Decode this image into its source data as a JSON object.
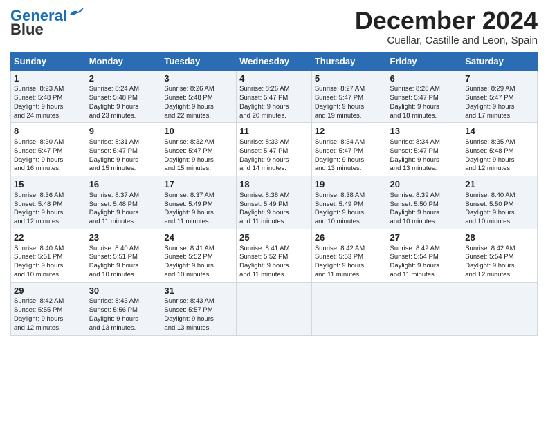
{
  "logo": {
    "line1": "General",
    "line2": "Blue"
  },
  "header": {
    "title": "December 2024",
    "subtitle": "Cuellar, Castille and Leon, Spain"
  },
  "days": [
    "Sunday",
    "Monday",
    "Tuesday",
    "Wednesday",
    "Thursday",
    "Friday",
    "Saturday"
  ],
  "weeks": [
    [
      {
        "day": "1",
        "info": "Sunrise: 8:23 AM\nSunset: 5:48 PM\nDaylight: 9 hours\nand 24 minutes."
      },
      {
        "day": "2",
        "info": "Sunrise: 8:24 AM\nSunset: 5:48 PM\nDaylight: 9 hours\nand 23 minutes."
      },
      {
        "day": "3",
        "info": "Sunrise: 8:26 AM\nSunset: 5:48 PM\nDaylight: 9 hours\nand 22 minutes."
      },
      {
        "day": "4",
        "info": "Sunrise: 8:26 AM\nSunset: 5:47 PM\nDaylight: 9 hours\nand 20 minutes."
      },
      {
        "day": "5",
        "info": "Sunrise: 8:27 AM\nSunset: 5:47 PM\nDaylight: 9 hours\nand 19 minutes."
      },
      {
        "day": "6",
        "info": "Sunrise: 8:28 AM\nSunset: 5:47 PM\nDaylight: 9 hours\nand 18 minutes."
      },
      {
        "day": "7",
        "info": "Sunrise: 8:29 AM\nSunset: 5:47 PM\nDaylight: 9 hours\nand 17 minutes."
      }
    ],
    [
      {
        "day": "8",
        "info": "Sunrise: 8:30 AM\nSunset: 5:47 PM\nDaylight: 9 hours\nand 16 minutes."
      },
      {
        "day": "9",
        "info": "Sunrise: 8:31 AM\nSunset: 5:47 PM\nDaylight: 9 hours\nand 15 minutes."
      },
      {
        "day": "10",
        "info": "Sunrise: 8:32 AM\nSunset: 5:47 PM\nDaylight: 9 hours\nand 15 minutes."
      },
      {
        "day": "11",
        "info": "Sunrise: 8:33 AM\nSunset: 5:47 PM\nDaylight: 9 hours\nand 14 minutes."
      },
      {
        "day": "12",
        "info": "Sunrise: 8:34 AM\nSunset: 5:47 PM\nDaylight: 9 hours\nand 13 minutes."
      },
      {
        "day": "13",
        "info": "Sunrise: 8:34 AM\nSunset: 5:47 PM\nDaylight: 9 hours\nand 13 minutes."
      },
      {
        "day": "14",
        "info": "Sunrise: 8:35 AM\nSunset: 5:48 PM\nDaylight: 9 hours\nand 12 minutes."
      }
    ],
    [
      {
        "day": "15",
        "info": "Sunrise: 8:36 AM\nSunset: 5:48 PM\nDaylight: 9 hours\nand 12 minutes."
      },
      {
        "day": "16",
        "info": "Sunrise: 8:37 AM\nSunset: 5:48 PM\nDaylight: 9 hours\nand 11 minutes."
      },
      {
        "day": "17",
        "info": "Sunrise: 8:37 AM\nSunset: 5:49 PM\nDaylight: 9 hours\nand 11 minutes."
      },
      {
        "day": "18",
        "info": "Sunrise: 8:38 AM\nSunset: 5:49 PM\nDaylight: 9 hours\nand 11 minutes."
      },
      {
        "day": "19",
        "info": "Sunrise: 8:38 AM\nSunset: 5:49 PM\nDaylight: 9 hours\nand 10 minutes."
      },
      {
        "day": "20",
        "info": "Sunrise: 8:39 AM\nSunset: 5:50 PM\nDaylight: 9 hours\nand 10 minutes."
      },
      {
        "day": "21",
        "info": "Sunrise: 8:40 AM\nSunset: 5:50 PM\nDaylight: 9 hours\nand 10 minutes."
      }
    ],
    [
      {
        "day": "22",
        "info": "Sunrise: 8:40 AM\nSunset: 5:51 PM\nDaylight: 9 hours\nand 10 minutes."
      },
      {
        "day": "23",
        "info": "Sunrise: 8:40 AM\nSunset: 5:51 PM\nDaylight: 9 hours\nand 10 minutes."
      },
      {
        "day": "24",
        "info": "Sunrise: 8:41 AM\nSunset: 5:52 PM\nDaylight: 9 hours\nand 10 minutes."
      },
      {
        "day": "25",
        "info": "Sunrise: 8:41 AM\nSunset: 5:52 PM\nDaylight: 9 hours\nand 11 minutes."
      },
      {
        "day": "26",
        "info": "Sunrise: 8:42 AM\nSunset: 5:53 PM\nDaylight: 9 hours\nand 11 minutes."
      },
      {
        "day": "27",
        "info": "Sunrise: 8:42 AM\nSunset: 5:54 PM\nDaylight: 9 hours\nand 11 minutes."
      },
      {
        "day": "28",
        "info": "Sunrise: 8:42 AM\nSunset: 5:54 PM\nDaylight: 9 hours\nand 12 minutes."
      }
    ],
    [
      {
        "day": "29",
        "info": "Sunrise: 8:42 AM\nSunset: 5:55 PM\nDaylight: 9 hours\nand 12 minutes."
      },
      {
        "day": "30",
        "info": "Sunrise: 8:43 AM\nSunset: 5:56 PM\nDaylight: 9 hours\nand 13 minutes."
      },
      {
        "day": "31",
        "info": "Sunrise: 8:43 AM\nSunset: 5:57 PM\nDaylight: 9 hours\nand 13 minutes."
      },
      {
        "day": "",
        "info": ""
      },
      {
        "day": "",
        "info": ""
      },
      {
        "day": "",
        "info": ""
      },
      {
        "day": "",
        "info": ""
      }
    ]
  ]
}
